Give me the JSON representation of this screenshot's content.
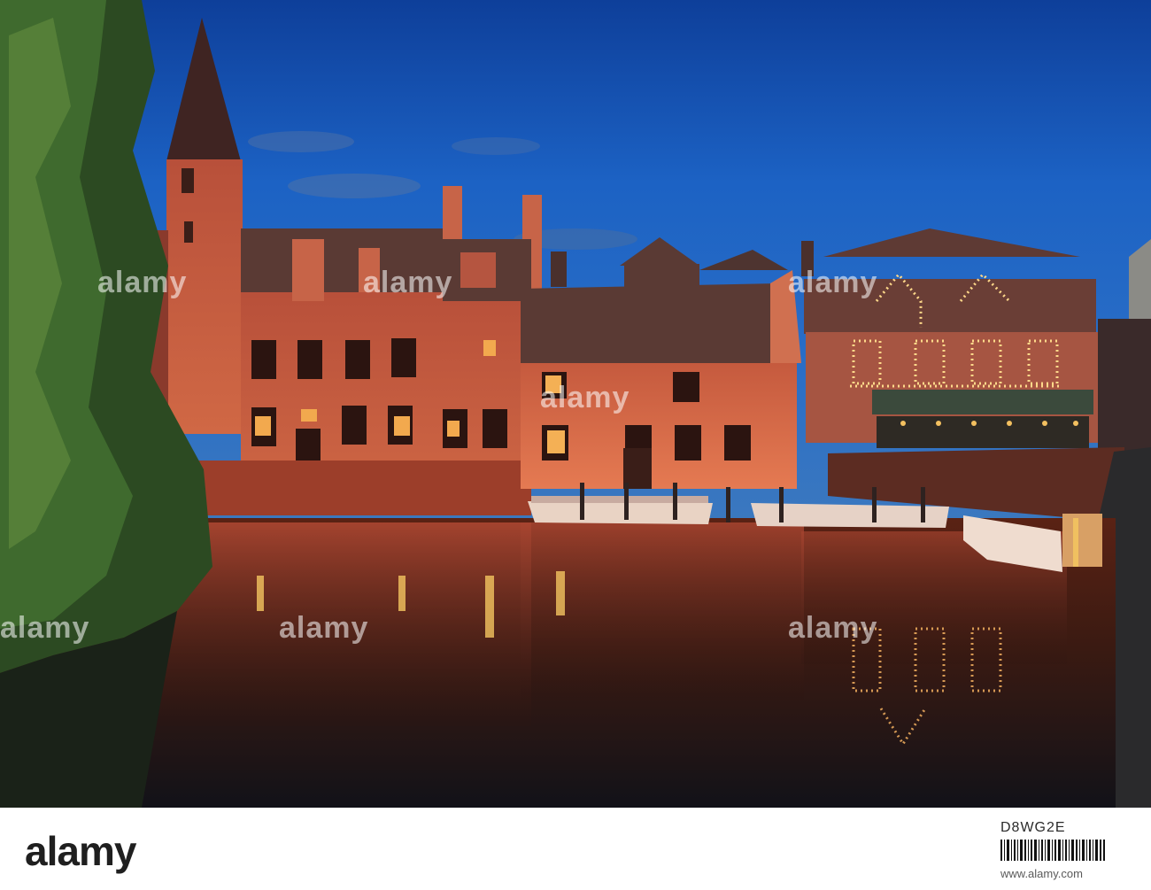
{
  "watermark": {
    "text": "alamy"
  },
  "footer": {
    "logo": "alamy",
    "image_id": "D8WG2E",
    "site": "www.alamy.com"
  }
}
